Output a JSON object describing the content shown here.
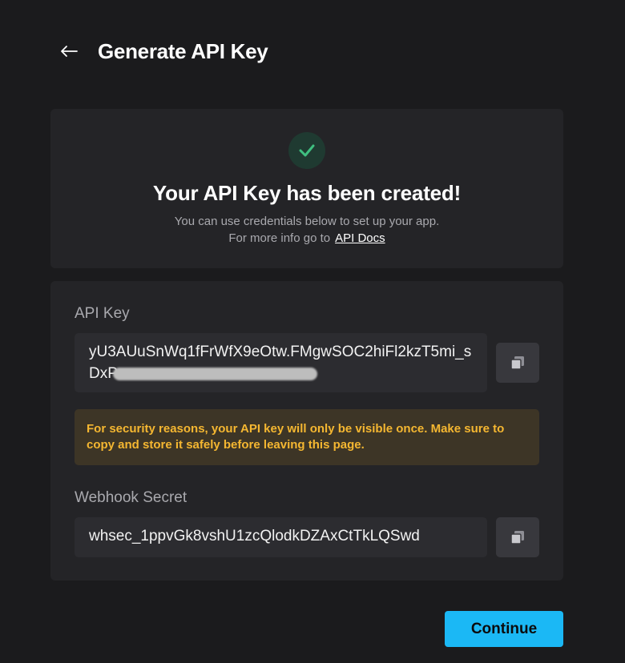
{
  "header": {
    "back_icon": "arrow-left-icon",
    "title": "Generate API Key"
  },
  "success": {
    "icon": "checkmark-icon",
    "title": "Your API Key has been created!",
    "subtitle": "You can use credentials below to set up your app.",
    "info_prefix": "For more info go to",
    "docs_link": "API Docs"
  },
  "credentials": {
    "api_key_label": "API Key",
    "api_key_value": "yU3AUuSnWq1fFrWfX9eOtw.FMgwSOC2hiFl2kzT5mi_sDxP",
    "api_key_copy_icon": "copy-icon",
    "warning": "For security reasons, your API key will only be visible once. Make sure to copy and store it safely before leaving this page.",
    "webhook_label": "Webhook Secret",
    "webhook_value": "whsec_1ppvGk8vshU1zcQlodkDZAxCtTkLQSwd",
    "webhook_copy_icon": "copy-icon"
  },
  "footer": {
    "continue_label": "Continue"
  },
  "colors": {
    "background": "#1b1b1d",
    "card": "#242427",
    "accent": "#1bb8f5",
    "success": "#3fbf80",
    "warning_text": "#f5b731",
    "warning_bg": "#3d3526"
  }
}
